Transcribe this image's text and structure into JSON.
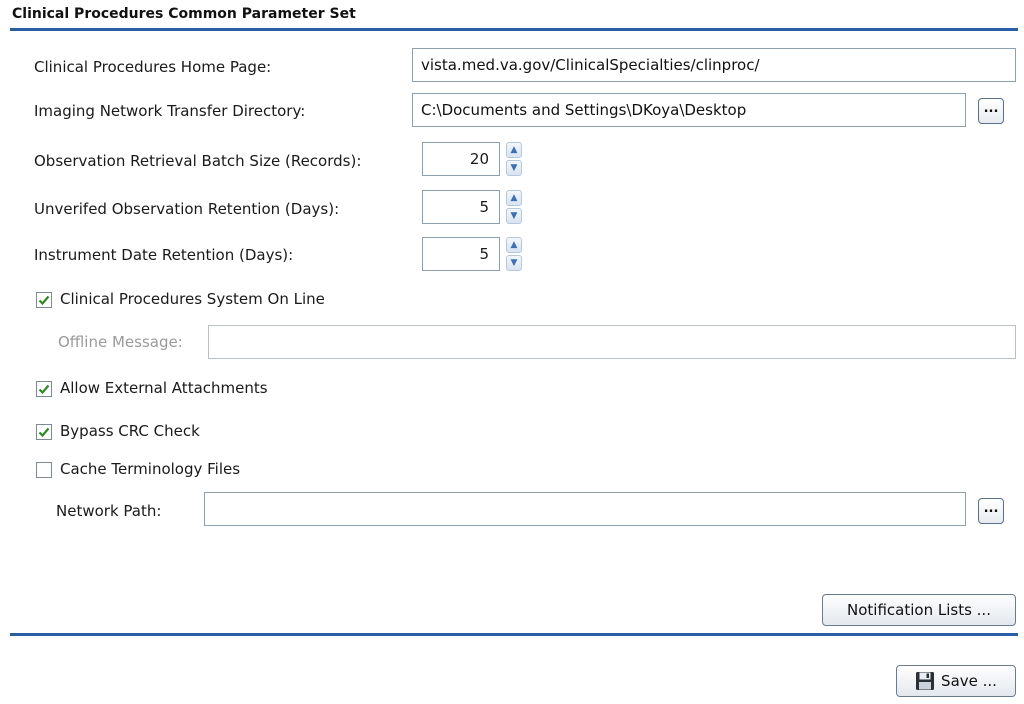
{
  "section": {
    "title": "Clinical Procedures Common Parameter Set"
  },
  "fields": {
    "home_page_label": "Clinical Procedures Home Page:",
    "home_page_value": "vista.med.va.gov/ClinicalSpecialties/clinproc/",
    "imaging_dir_label": "Imaging Network Transfer Directory:",
    "imaging_dir_value": "C:\\Documents and Settings\\DKoya\\Desktop",
    "batch_size_label": "Observation Retrieval Batch Size (Records):",
    "batch_size_value": "20",
    "unverified_retention_label": "Unverifed Observation Retention (Days):",
    "unverified_retention_value": "5",
    "instrument_retention_label": "Instrument Date Retention (Days):",
    "instrument_retention_value": "5",
    "offline_message_label": "Offline Message:",
    "offline_message_value": "",
    "network_path_label": "Network Path:",
    "network_path_value": ""
  },
  "checkboxes": {
    "online": {
      "label": "Clinical Procedures System On Line",
      "checked": true
    },
    "external_attachments": {
      "label": "Allow External Attachments",
      "checked": true
    },
    "bypass_crc": {
      "label": "Bypass CRC Check",
      "checked": true
    },
    "cache_terminology": {
      "label": "Cache Terminology Files",
      "checked": false
    }
  },
  "buttons": {
    "browse_label": "...",
    "notification_lists": "Notification Lists ...",
    "save": "Save ..."
  },
  "icons": {
    "spin_up": "chevron-up-icon",
    "spin_down": "chevron-down-icon",
    "check": "checkmark-icon",
    "save": "floppy-disk-icon"
  },
  "colors": {
    "rule": "#2a5fa5",
    "check": "#2e8b22"
  }
}
